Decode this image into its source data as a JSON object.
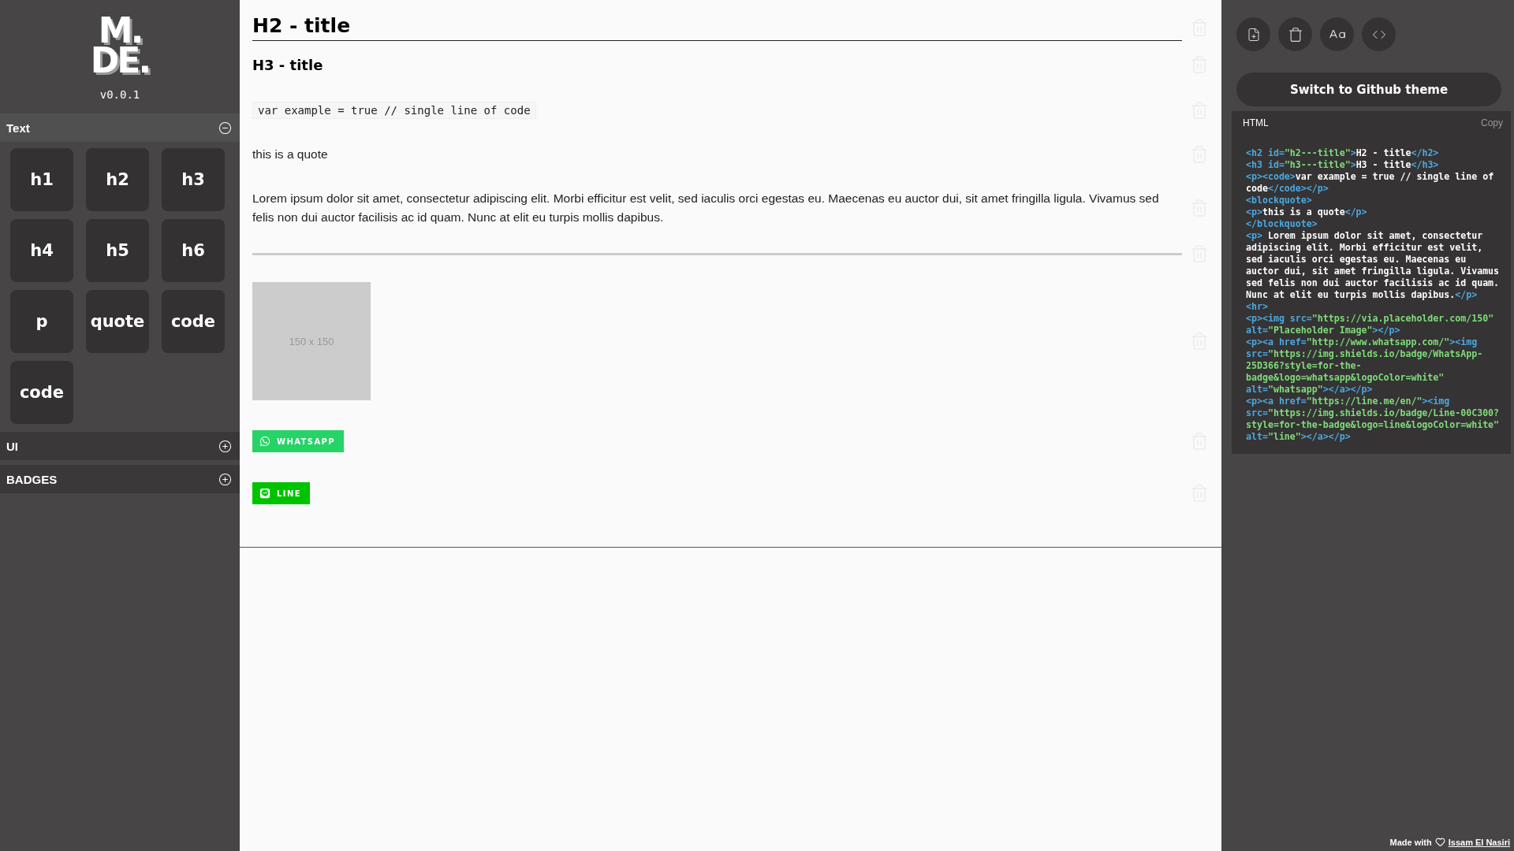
{
  "sidebar": {
    "logo": [
      "M.",
      "DE."
    ],
    "version": "v0.0.1",
    "sections": [
      {
        "title": "Text",
        "expanded": true,
        "items": [
          "h1",
          "h2",
          "h3",
          "h4",
          "h5",
          "h6",
          "p",
          "quote",
          "code",
          "code"
        ]
      },
      {
        "title": "UI",
        "expanded": false
      },
      {
        "title": "BADGES",
        "expanded": false
      }
    ]
  },
  "editor": {
    "blocks": [
      {
        "kind": "h2",
        "text": "H2 - title"
      },
      {
        "kind": "h3",
        "text": "H3 - title"
      },
      {
        "kind": "code",
        "text": "var example = true // single line of code"
      },
      {
        "kind": "quote",
        "text": "this is a quote"
      },
      {
        "kind": "p",
        "text": "Lorem ipsum dolor sit amet, consectetur adipiscing elit. Morbi efficitur est velit, sed iaculis orci egestas eu. Maecenas eu auctor dui, sit amet fringilla ligula. Vivamus sed felis non dui auctor facilisis ac id quam. Nunc at elit eu turpis mollis dapibus."
      },
      {
        "kind": "hr"
      },
      {
        "kind": "image",
        "text": "150 x 150"
      },
      {
        "kind": "whatsapp",
        "text": "WHATSAPP",
        "color": "#25d366"
      },
      {
        "kind": "line",
        "text": "LINE",
        "color": "#00c300"
      }
    ]
  },
  "right_panel": {
    "theme_button": "Switch to Github theme",
    "code_panel": {
      "title": "HTML",
      "copy": "Copy",
      "lines": [
        [
          {
            "kind": "tag",
            "text": "<h2 id="
          },
          {
            "kind": "value",
            "text": "\"h2---title\""
          },
          {
            "kind": "tag",
            "text": ">"
          },
          {
            "kind": "text",
            "text": "H2 - title"
          },
          {
            "kind": "tag",
            "text": "</h2>"
          }
        ],
        [
          {
            "kind": "tag",
            "text": "<h3 id="
          },
          {
            "kind": "value",
            "text": "\"h3---title\""
          },
          {
            "kind": "tag",
            "text": ">"
          },
          {
            "kind": "text",
            "text": "H3 - title"
          },
          {
            "kind": "tag",
            "text": "</h3>"
          }
        ],
        [
          {
            "kind": "tag",
            "text": "<p><code>"
          },
          {
            "kind": "text",
            "text": "var example = true // single line of code"
          },
          {
            "kind": "tag",
            "text": "</code></p>"
          }
        ],
        [
          {
            "kind": "tag",
            "text": "<blockquote>"
          }
        ],
        [
          {
            "kind": "tag",
            "text": "<p>"
          },
          {
            "kind": "text",
            "text": "this is a quote"
          },
          {
            "kind": "tag",
            "text": "</p>"
          }
        ],
        [
          {
            "kind": "tag",
            "text": "</blockquote>"
          }
        ],
        [
          {
            "kind": "tag",
            "text": "<p>"
          },
          {
            "kind": "text",
            "text": " Lorem ipsum dolor sit amet, consectetur adipiscing elit. Morbi efficitur est velit, sed iaculis orci egestas eu. Maecenas eu auctor dui, sit amet fringilla ligula. Vivamus sed felis non dui auctor facilisis ac id quam. Nunc at elit eu turpis mollis dapibus."
          },
          {
            "kind": "tag",
            "text": "</p>"
          }
        ],
        [
          {
            "kind": "tag",
            "text": "<hr>"
          }
        ],
        [
          {
            "kind": "tag",
            "text": "<p><img src="
          },
          {
            "kind": "value",
            "text": "\"https://via.placeholder.com/150\""
          },
          {
            "kind": "tag",
            "text": " alt="
          },
          {
            "kind": "value",
            "text": "\"Placeholder Image\""
          },
          {
            "kind": "tag",
            "text": "></p>"
          }
        ],
        [
          {
            "kind": "tag",
            "text": "<p><a href="
          },
          {
            "kind": "value",
            "text": "\"http://www.whatsapp.com/\""
          },
          {
            "kind": "tag",
            "text": "><img src="
          },
          {
            "kind": "value",
            "text": "\"https://img.shields.io/badge/WhatsApp-25D366?style=for-the-badge&logo=whatsapp&logoColor=white\""
          },
          {
            "kind": "tag",
            "text": " alt="
          },
          {
            "kind": "value",
            "text": "\"whatsapp\""
          },
          {
            "kind": "tag",
            "text": "></a></p>"
          }
        ],
        [
          {
            "kind": "tag",
            "text": "<p><a href="
          },
          {
            "kind": "value",
            "text": "\"https://line.me/en/\""
          },
          {
            "kind": "tag",
            "text": "><img src="
          },
          {
            "kind": "value",
            "text": "\"https://img.shields.io/badge/Line-00C300?style=for-the-badge&logo=line&logoColor=white\""
          },
          {
            "kind": "tag",
            "text": " alt="
          },
          {
            "kind": "value",
            "text": "\"line\""
          },
          {
            "kind": "tag",
            "text": "></a></p>"
          }
        ]
      ]
    },
    "footer": {
      "text": "Made with",
      "author": "Issam El Nasiri"
    }
  }
}
